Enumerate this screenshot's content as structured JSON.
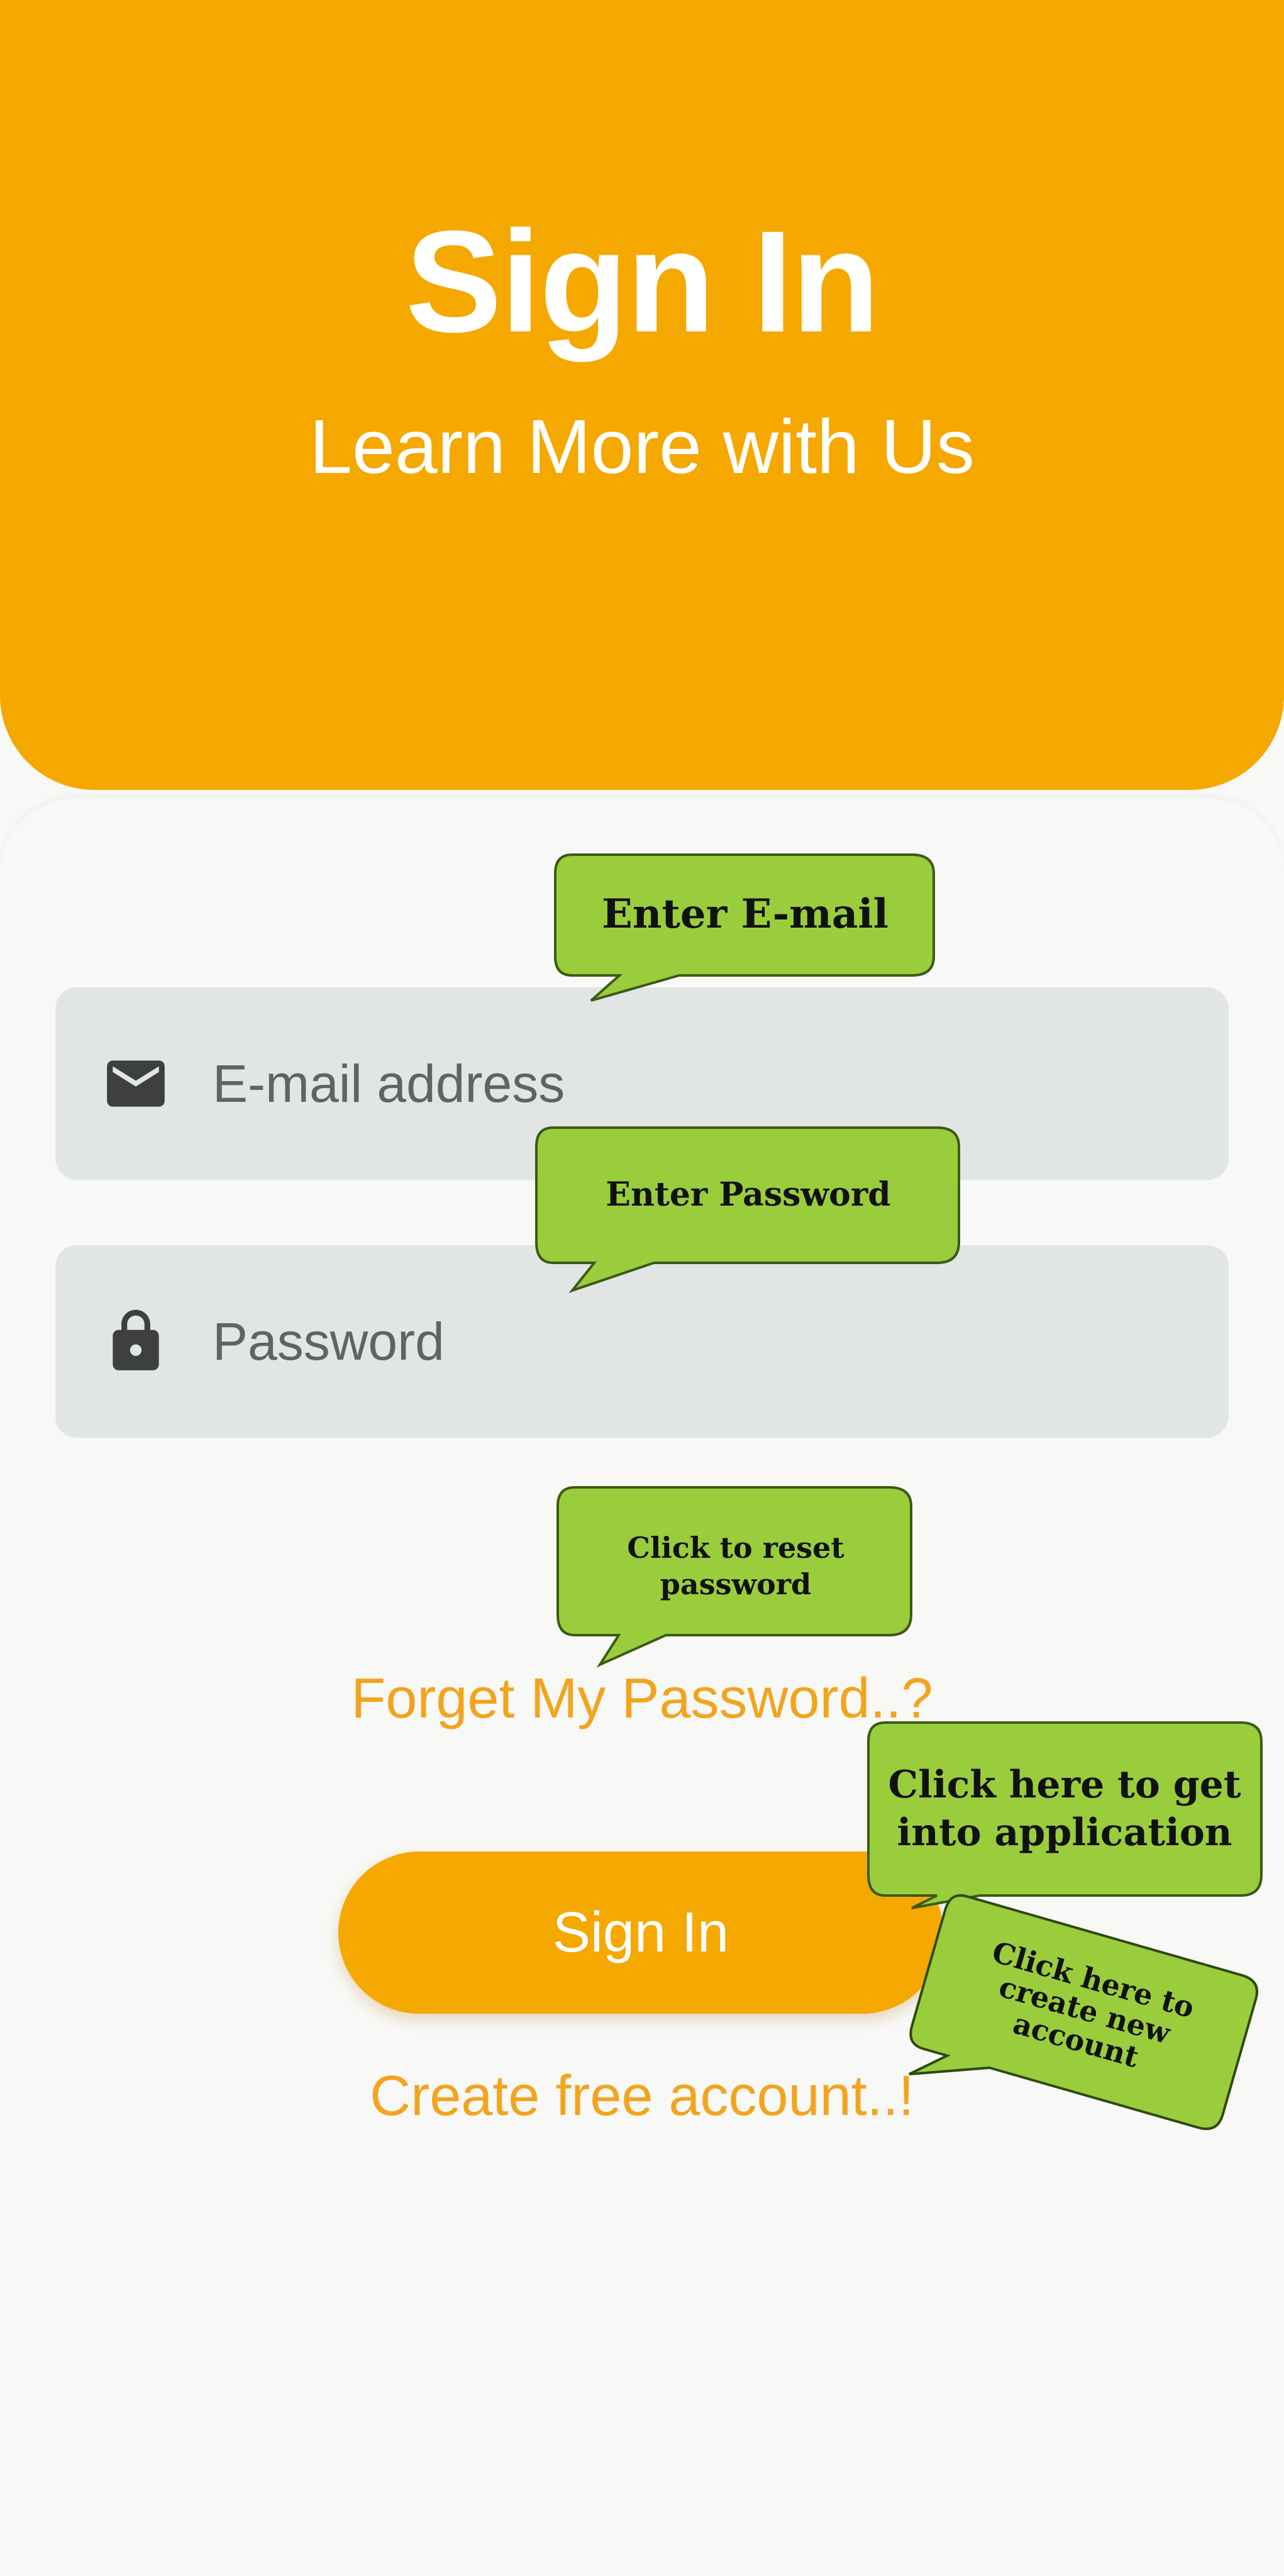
{
  "header": {
    "title": "Sign In",
    "subtitle": "Learn More with Us"
  },
  "form": {
    "email_placeholder": "E-mail address",
    "email_value": "",
    "email_icon": "mail-icon",
    "password_placeholder": "Password",
    "password_value": "",
    "password_icon": "lock-icon",
    "forgot_link": "Forget My Password..?",
    "signin_button": "Sign In",
    "create_account_link": "Create free account..!"
  },
  "callouts": {
    "email": "Enter E-mail",
    "password": "Enter Password",
    "reset": "Click to reset password",
    "signin": "Click here to get into application",
    "create": "Click here to create new account"
  },
  "colors": {
    "brand": "#f5a800",
    "link": "#f2a41e",
    "field_bg": "#e1e6e4",
    "callout_bg": "#9acd3c",
    "background": "#f8f8f6"
  }
}
